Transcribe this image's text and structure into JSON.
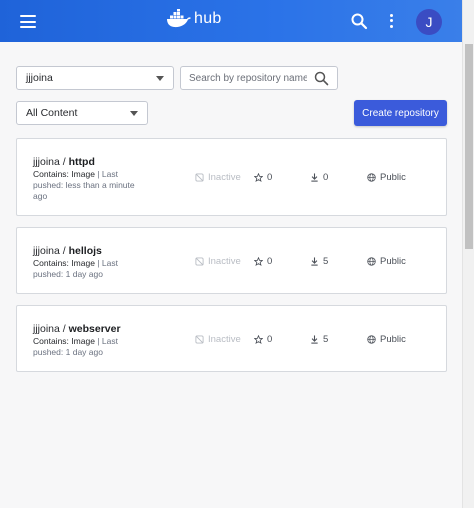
{
  "header": {
    "logo_text": "hub",
    "avatar_initial": "J",
    "color": "#2b73e8"
  },
  "controls": {
    "namespace": "jjjoina",
    "search_placeholder": "Search by repository name",
    "filter": "All Content",
    "create_label": "Create repository",
    "create_color": "#3b5bdb"
  },
  "repos": [
    {
      "namespace": "jjjoina",
      "sep": " / ",
      "name": "httpd",
      "contains_label": "Contains:",
      "contains_value": "Image",
      "last_pushed_label": "| Last pushed:",
      "last_pushed_value": "less than a minute ago",
      "status": "Inactive",
      "stars": "0",
      "pulls": "0",
      "visibility": "Public"
    },
    {
      "namespace": "jjjoina",
      "sep": " / ",
      "name": "hellojs",
      "contains_label": "Contains:",
      "contains_value": "Image",
      "last_pushed_label": "| Last pushed:",
      "last_pushed_value": "1 day ago",
      "status": "Inactive",
      "stars": "0",
      "pulls": "5",
      "visibility": "Public"
    },
    {
      "namespace": "jjjoina",
      "sep": " / ",
      "name": "webserver",
      "contains_label": "Contains:",
      "contains_value": "Image",
      "last_pushed_label": "| Last pushed:",
      "last_pushed_value": "1 day ago",
      "status": "Inactive",
      "stars": "0",
      "pulls": "5",
      "visibility": "Public"
    }
  ]
}
